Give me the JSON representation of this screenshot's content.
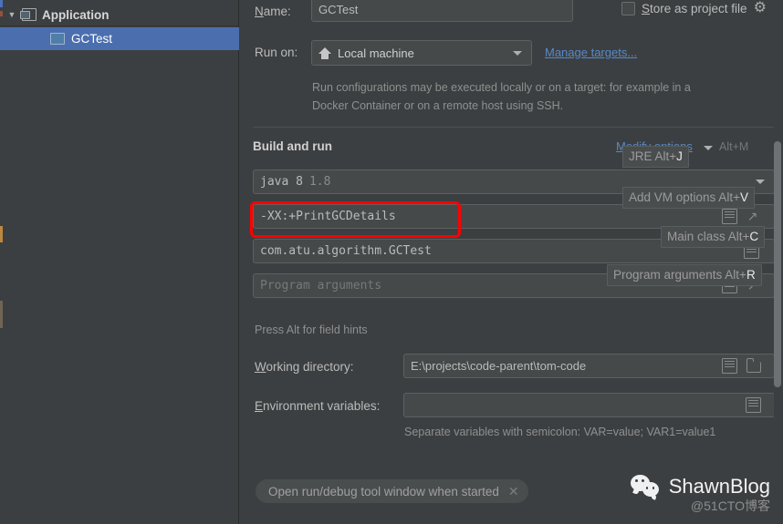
{
  "sidebar": {
    "items": [
      {
        "label": "Application",
        "icon": "application-icon",
        "expanded": true
      },
      {
        "label": "GCTest",
        "icon": "class-icon",
        "selected": true
      }
    ]
  },
  "form": {
    "name": {
      "label": "Name:",
      "mnemonic": "N",
      "value": "GCTest"
    },
    "store_as_project_file": {
      "label": "Store as project file",
      "mnemonic": "S",
      "checked": false,
      "gear_icon": "gear-icon"
    },
    "run_on": {
      "label": "Run on:",
      "value": "Local machine",
      "icon": "home-icon",
      "manage_targets_link": "Manage targets...",
      "description": "Run configurations may be executed locally or on a target: for example in a Docker Container or on a remote host using SSH."
    },
    "build_and_run": {
      "section_title": "Build and run",
      "modify_options_link": "Modify options",
      "modify_options_shortcut": "Alt+M",
      "jre": {
        "value": "java 8",
        "version": "1.8"
      },
      "vm_options": {
        "value": "-XX:+PrintGCDetails"
      },
      "main_class": {
        "value": "com.atu.algorithm.GCTest"
      },
      "program_arguments": {
        "placeholder": "Program arguments"
      },
      "alt_hint": "Press Alt for field hints"
    },
    "working_directory": {
      "label": "Working directory:",
      "mnemonic": "W",
      "value": "E:\\projects\\code-parent\\tom-code"
    },
    "environment_variables": {
      "label": "Environment variables:",
      "mnemonic": "E",
      "value": "",
      "hint": "Separate variables with semicolon: VAR=value; VAR1=value1"
    },
    "chip": {
      "label": "Open run/debug tool window when started",
      "close_icon": "close-icon"
    }
  },
  "tips": [
    {
      "text": "JRE Alt+",
      "key": "J",
      "name": "tip-jre"
    },
    {
      "text": "Add VM options Alt+",
      "key": "V",
      "name": "tip-vm-options"
    },
    {
      "text": "Main class Alt+",
      "key": "C",
      "name": "tip-main-class"
    },
    {
      "text": "Program arguments Alt+",
      "key": "R",
      "name": "tip-program-arguments"
    }
  ],
  "annotation": {
    "color": "#ff0000",
    "target": "vm-options-field"
  },
  "watermark": {
    "title": "ShawnBlog",
    "subtitle": "@51CTO博客",
    "icon": "wechat-icon"
  },
  "colors": {
    "background": "#3c3f41",
    "field_bg": "#45494a",
    "selection": "#4b6eaf",
    "link": "#5789c8",
    "annotation": "#ff0000"
  }
}
